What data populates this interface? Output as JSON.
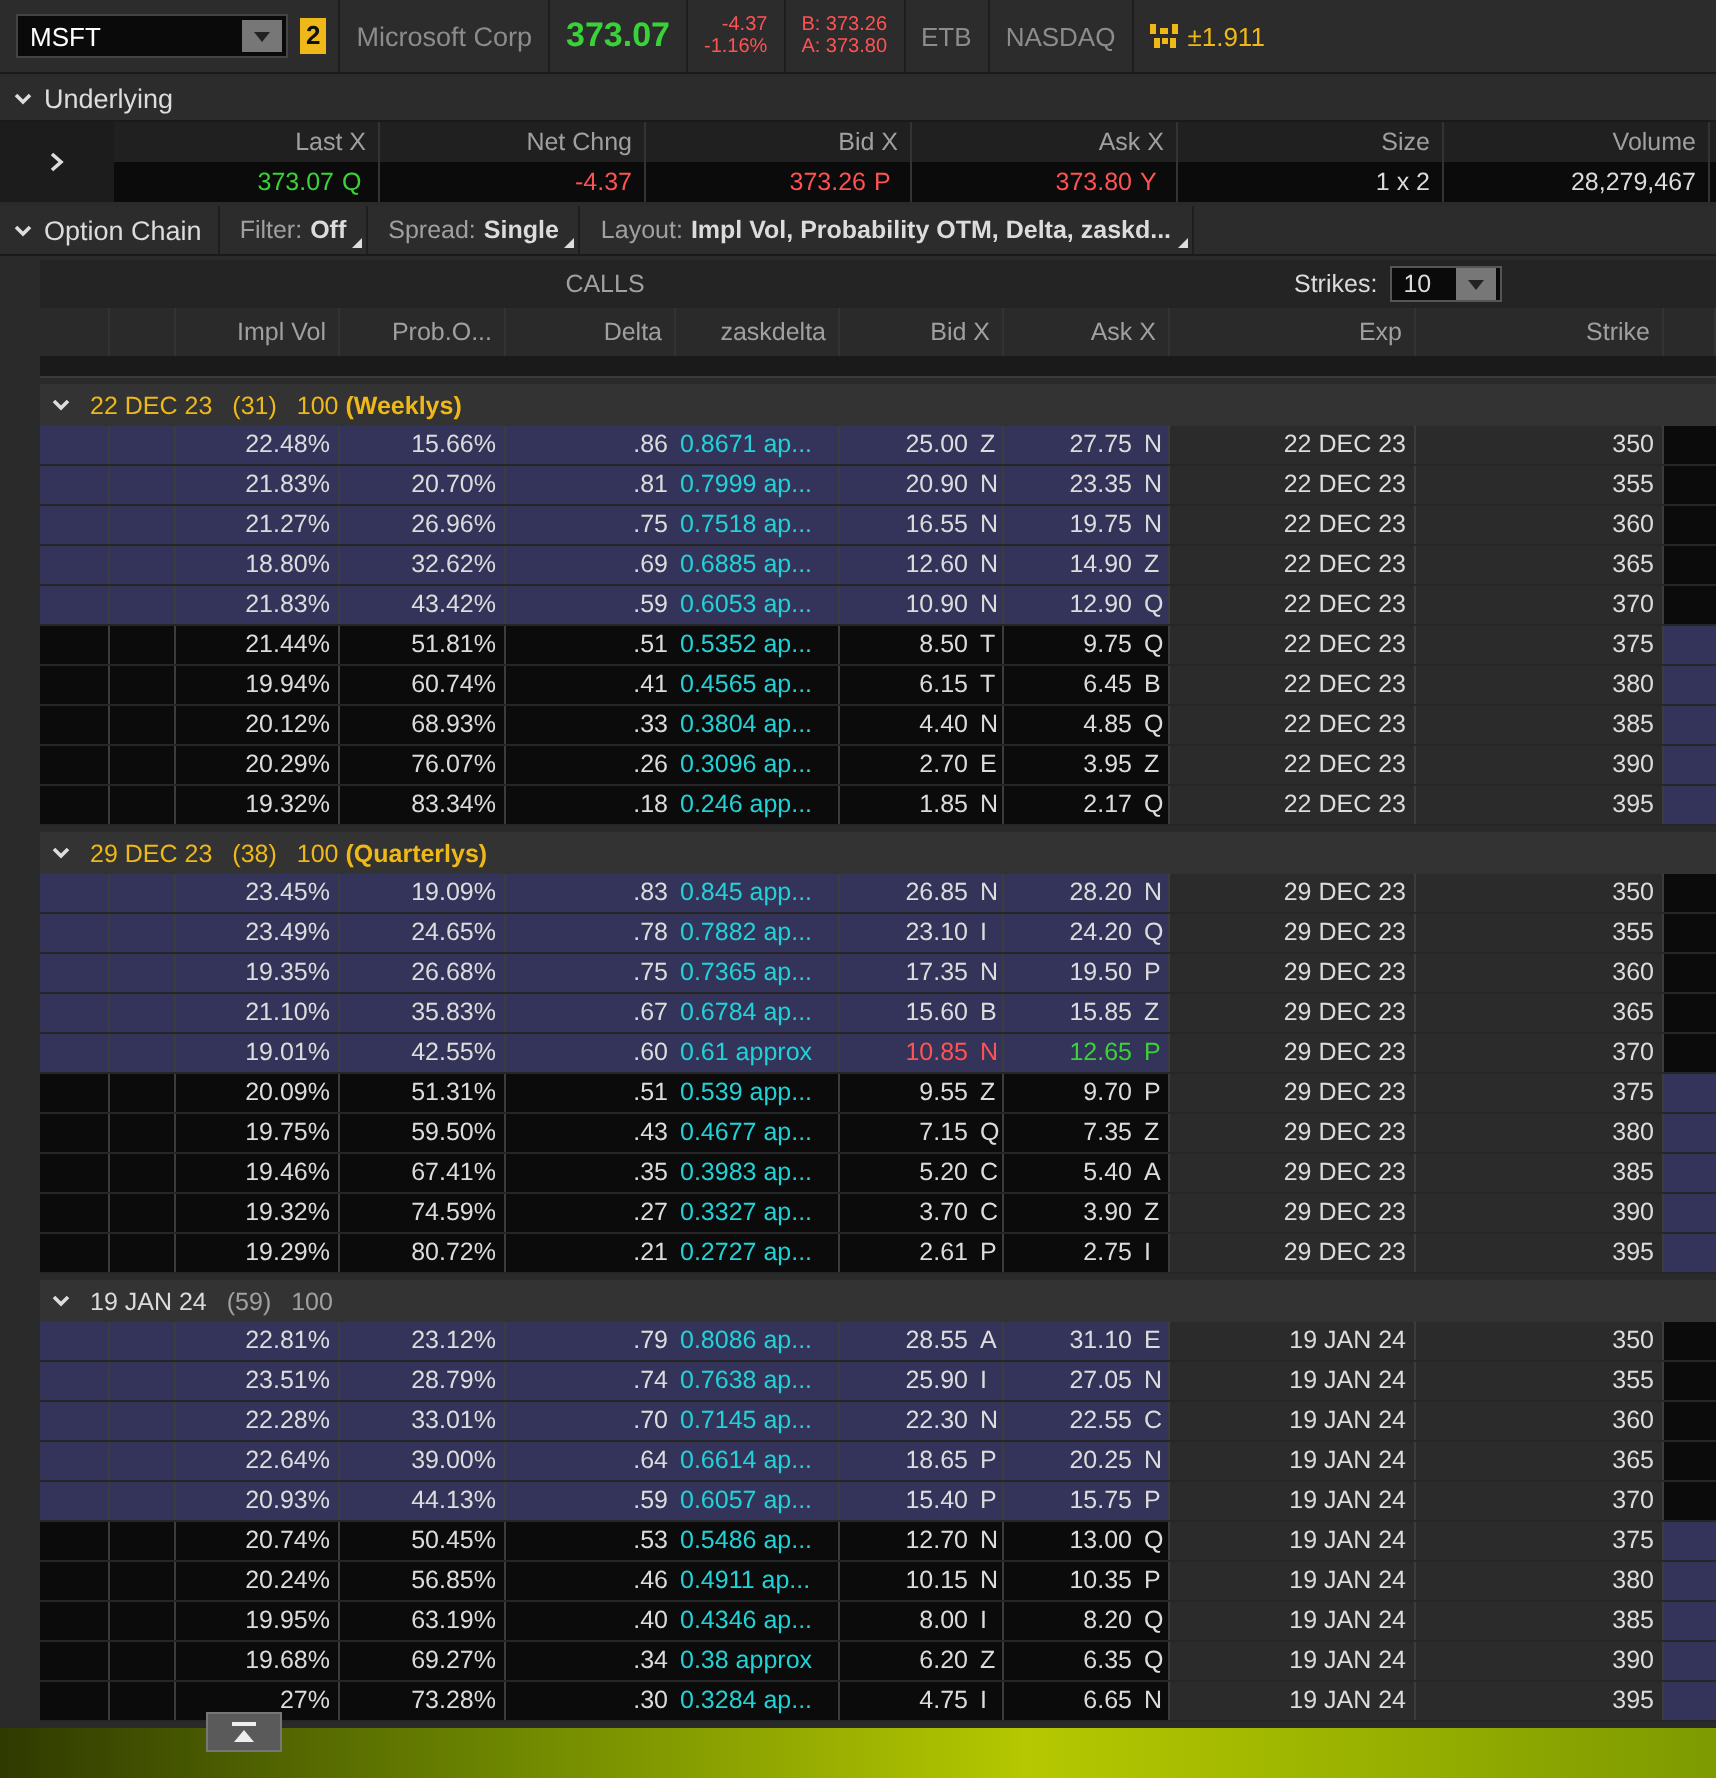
{
  "quote_bar": {
    "symbol": "MSFT",
    "badge": "2",
    "company": "Microsoft Corp",
    "last": "373.07",
    "change": "-4.37",
    "change_pct": "-1.16%",
    "bid": "B: 373.26",
    "ask": "A: 373.80",
    "borrow": "ETB",
    "exchange": "NASDAQ",
    "move": "±1.911"
  },
  "underlying": {
    "title": "Underlying",
    "expanded": true,
    "columns": [
      {
        "label": "Last X",
        "value": "373.07",
        "exchange": "Q",
        "up": true,
        "down": false
      },
      {
        "label": "Net Chng",
        "value": "-4.37",
        "up": false,
        "down": true
      },
      {
        "label": "Bid X",
        "value": "373.26",
        "exchange": "P",
        "up": false,
        "down": true
      },
      {
        "label": "Ask X",
        "value": "373.80",
        "exchange": "Y",
        "up": false,
        "down": true
      },
      {
        "label": "Size",
        "value": "1 x 2",
        "up": false,
        "down": false
      },
      {
        "label": "Volume",
        "value": "28,279,467",
        "up": false,
        "down": false
      }
    ]
  },
  "option_chain": {
    "title": "Option Chain",
    "expanded": true,
    "filter_label": "Filter:",
    "filter": "Off",
    "spread_label": "Spread:",
    "spread": "Single",
    "layout_label": "Layout:",
    "layout": "Impl Vol, Probability OTM, Delta, zaskd...",
    "calls_label": "CALLS",
    "strikes_label": "Strikes:",
    "strikes": "10"
  },
  "columns": [
    "Impl Vol",
    "Prob.O...",
    "Delta",
    "zaskdelta",
    "Bid X",
    "Ask X",
    "Exp",
    "Strike"
  ],
  "sections": [
    {
      "date": "22 DEC 23",
      "count": "(31)",
      "multiplier": "100",
      "tag": "(Weeklys)",
      "highlight": true,
      "expanded": true,
      "rows": [
        {
          "iv": "22.48%",
          "prob": "15.66%",
          "delta": ".86",
          "zask": "0.8671 ap...",
          "bid": "25.00",
          "bid_ex": "Z",
          "ask": "27.75",
          "ask_ex": "N",
          "exp": "22 DEC 23",
          "strike": "350",
          "itm": true,
          "bid_down": false,
          "ask_up": false
        },
        {
          "iv": "21.83%",
          "prob": "20.70%",
          "delta": ".81",
          "zask": "0.7999 ap...",
          "bid": "20.90",
          "bid_ex": "N",
          "ask": "23.35",
          "ask_ex": "N",
          "exp": "22 DEC 23",
          "strike": "355",
          "itm": true,
          "bid_down": false,
          "ask_up": false
        },
        {
          "iv": "21.27%",
          "prob": "26.96%",
          "delta": ".75",
          "zask": "0.7518 ap...",
          "bid": "16.55",
          "bid_ex": "N",
          "ask": "19.75",
          "ask_ex": "N",
          "exp": "22 DEC 23",
          "strike": "360",
          "itm": true,
          "bid_down": false,
          "ask_up": false
        },
        {
          "iv": "18.80%",
          "prob": "32.62%",
          "delta": ".69",
          "zask": "0.6885 ap...",
          "bid": "12.60",
          "bid_ex": "N",
          "ask": "14.90",
          "ask_ex": "Z",
          "exp": "22 DEC 23",
          "strike": "365",
          "itm": true,
          "bid_down": false,
          "ask_up": false
        },
        {
          "iv": "21.83%",
          "prob": "43.42%",
          "delta": ".59",
          "zask": "0.6053 ap...",
          "bid": "10.90",
          "bid_ex": "N",
          "ask": "12.90",
          "ask_ex": "Q",
          "exp": "22 DEC 23",
          "strike": "370",
          "itm": true,
          "bid_down": false,
          "ask_up": false
        },
        {
          "iv": "21.44%",
          "prob": "51.81%",
          "delta": ".51",
          "zask": "0.5352 ap...",
          "bid": "8.50",
          "bid_ex": "T",
          "ask": "9.75",
          "ask_ex": "Q",
          "exp": "22 DEC 23",
          "strike": "375",
          "itm": false,
          "bid_down": false,
          "ask_up": false
        },
        {
          "iv": "19.94%",
          "prob": "60.74%",
          "delta": ".41",
          "zask": "0.4565 ap...",
          "bid": "6.15",
          "bid_ex": "T",
          "ask": "6.45",
          "ask_ex": "B",
          "exp": "22 DEC 23",
          "strike": "380",
          "itm": false,
          "bid_down": false,
          "ask_up": false
        },
        {
          "iv": "20.12%",
          "prob": "68.93%",
          "delta": ".33",
          "zask": "0.3804 ap...",
          "bid": "4.40",
          "bid_ex": "N",
          "ask": "4.85",
          "ask_ex": "Q",
          "exp": "22 DEC 23",
          "strike": "385",
          "itm": false,
          "bid_down": false,
          "ask_up": false
        },
        {
          "iv": "20.29%",
          "prob": "76.07%",
          "delta": ".26",
          "zask": "0.3096 ap...",
          "bid": "2.70",
          "bid_ex": "E",
          "ask": "3.95",
          "ask_ex": "Z",
          "exp": "22 DEC 23",
          "strike": "390",
          "itm": false,
          "bid_down": false,
          "ask_up": false
        },
        {
          "iv": "19.32%",
          "prob": "83.34%",
          "delta": ".18",
          "zask": "0.246 app...",
          "bid": "1.85",
          "bid_ex": "N",
          "ask": "2.17",
          "ask_ex": "Q",
          "exp": "22 DEC 23",
          "strike": "395",
          "itm": false,
          "bid_down": false,
          "ask_up": false
        }
      ]
    },
    {
      "date": "29 DEC 23",
      "count": "(38)",
      "multiplier": "100",
      "tag": "(Quarterlys)",
      "highlight": true,
      "expanded": true,
      "rows": [
        {
          "iv": "23.45%",
          "prob": "19.09%",
          "delta": ".83",
          "zask": "0.845 app...",
          "bid": "26.85",
          "bid_ex": "N",
          "ask": "28.20",
          "ask_ex": "N",
          "exp": "29 DEC 23",
          "strike": "350",
          "itm": true,
          "bid_down": false,
          "ask_up": false
        },
        {
          "iv": "23.49%",
          "prob": "24.65%",
          "delta": ".78",
          "zask": "0.7882 ap...",
          "bid": "23.10",
          "bid_ex": "I",
          "ask": "24.20",
          "ask_ex": "Q",
          "exp": "29 DEC 23",
          "strike": "355",
          "itm": true,
          "bid_down": false,
          "ask_up": false
        },
        {
          "iv": "19.35%",
          "prob": "26.68%",
          "delta": ".75",
          "zask": "0.7365 ap...",
          "bid": "17.35",
          "bid_ex": "N",
          "ask": "19.50",
          "ask_ex": "P",
          "exp": "29 DEC 23",
          "strike": "360",
          "itm": true,
          "bid_down": false,
          "ask_up": false
        },
        {
          "iv": "21.10%",
          "prob": "35.83%",
          "delta": ".67",
          "zask": "0.6784 ap...",
          "bid": "15.60",
          "bid_ex": "B",
          "ask": "15.85",
          "ask_ex": "Z",
          "exp": "29 DEC 23",
          "strike": "365",
          "itm": true,
          "bid_down": false,
          "ask_up": false
        },
        {
          "iv": "19.01%",
          "prob": "42.55%",
          "delta": ".60",
          "zask": "0.61 approx",
          "bid": "10.85",
          "bid_ex": "N",
          "ask": "12.65",
          "ask_ex": "P",
          "exp": "29 DEC 23",
          "strike": "370",
          "itm": true,
          "bid_down": true,
          "ask_up": true
        },
        {
          "iv": "20.09%",
          "prob": "51.31%",
          "delta": ".51",
          "zask": "0.539 app...",
          "bid": "9.55",
          "bid_ex": "Z",
          "ask": "9.70",
          "ask_ex": "P",
          "exp": "29 DEC 23",
          "strike": "375",
          "itm": false,
          "bid_down": false,
          "ask_up": false
        },
        {
          "iv": "19.75%",
          "prob": "59.50%",
          "delta": ".43",
          "zask": "0.4677 ap...",
          "bid": "7.15",
          "bid_ex": "Q",
          "ask": "7.35",
          "ask_ex": "Z",
          "exp": "29 DEC 23",
          "strike": "380",
          "itm": false,
          "bid_down": false,
          "ask_up": false
        },
        {
          "iv": "19.46%",
          "prob": "67.41%",
          "delta": ".35",
          "zask": "0.3983 ap...",
          "bid": "5.20",
          "bid_ex": "C",
          "ask": "5.40",
          "ask_ex": "A",
          "exp": "29 DEC 23",
          "strike": "385",
          "itm": false,
          "bid_down": false,
          "ask_up": false
        },
        {
          "iv": "19.32%",
          "prob": "74.59%",
          "delta": ".27",
          "zask": "0.3327 ap...",
          "bid": "3.70",
          "bid_ex": "C",
          "ask": "3.90",
          "ask_ex": "Z",
          "exp": "29 DEC 23",
          "strike": "390",
          "itm": false,
          "bid_down": false,
          "ask_up": false
        },
        {
          "iv": "19.29%",
          "prob": "80.72%",
          "delta": ".21",
          "zask": "0.2727 ap...",
          "bid": "2.61",
          "bid_ex": "P",
          "ask": "2.75",
          "ask_ex": "I",
          "exp": "29 DEC 23",
          "strike": "395",
          "itm": false,
          "bid_down": false,
          "ask_up": false
        }
      ]
    },
    {
      "date": "19 JAN 24",
      "count": "(59)",
      "multiplier": "100",
      "highlight": false,
      "expanded": true,
      "rows": [
        {
          "iv": "22.81%",
          "prob": "23.12%",
          "delta": ".79",
          "zask": "0.8086 ap...",
          "bid": "28.55",
          "bid_ex": "A",
          "ask": "31.10",
          "ask_ex": "E",
          "exp": "19 JAN 24",
          "strike": "350",
          "itm": true,
          "bid_down": false,
          "ask_up": false
        },
        {
          "iv": "23.51%",
          "prob": "28.79%",
          "delta": ".74",
          "zask": "0.7638 ap...",
          "bid": "25.90",
          "bid_ex": "I",
          "ask": "27.05",
          "ask_ex": "N",
          "exp": "19 JAN 24",
          "strike": "355",
          "itm": true,
          "bid_down": false,
          "ask_up": false
        },
        {
          "iv": "22.28%",
          "prob": "33.01%",
          "delta": ".70",
          "zask": "0.7145 ap...",
          "bid": "22.30",
          "bid_ex": "N",
          "ask": "22.55",
          "ask_ex": "C",
          "exp": "19 JAN 24",
          "strike": "360",
          "itm": true,
          "bid_down": false,
          "ask_up": false
        },
        {
          "iv": "22.64%",
          "prob": "39.00%",
          "delta": ".64",
          "zask": "0.6614 ap...",
          "bid": "18.65",
          "bid_ex": "P",
          "ask": "20.25",
          "ask_ex": "N",
          "exp": "19 JAN 24",
          "strike": "365",
          "itm": true,
          "bid_down": false,
          "ask_up": false
        },
        {
          "iv": "20.93%",
          "prob": "44.13%",
          "delta": ".59",
          "zask": "0.6057 ap...",
          "bid": "15.40",
          "bid_ex": "P",
          "ask": "15.75",
          "ask_ex": "P",
          "exp": "19 JAN 24",
          "strike": "370",
          "itm": true,
          "bid_down": false,
          "ask_up": false
        },
        {
          "iv": "20.74%",
          "prob": "50.45%",
          "delta": ".53",
          "zask": "0.5486 ap...",
          "bid": "12.70",
          "bid_ex": "N",
          "ask": "13.00",
          "ask_ex": "Q",
          "exp": "19 JAN 24",
          "strike": "375",
          "itm": false,
          "bid_down": false,
          "ask_up": false
        },
        {
          "iv": "20.24%",
          "prob": "56.85%",
          "delta": ".46",
          "zask": "0.4911 ap...",
          "bid": "10.15",
          "bid_ex": "N",
          "ask": "10.35",
          "ask_ex": "P",
          "exp": "19 JAN 24",
          "strike": "380",
          "itm": false,
          "bid_down": false,
          "ask_up": false
        },
        {
          "iv": "19.95%",
          "prob": "63.19%",
          "delta": ".40",
          "zask": "0.4346 ap...",
          "bid": "8.00",
          "bid_ex": "I",
          "ask": "8.20",
          "ask_ex": "Q",
          "exp": "19 JAN 24",
          "strike": "385",
          "itm": false,
          "bid_down": false,
          "ask_up": false
        },
        {
          "iv": "19.68%",
          "prob": "69.27%",
          "delta": ".34",
          "zask": "0.38 approx",
          "bid": "6.20",
          "bid_ex": "Z",
          "ask": "6.35",
          "ask_ex": "Q",
          "exp": "19 JAN 24",
          "strike": "390",
          "itm": false,
          "bid_down": false,
          "ask_up": false
        },
        {
          "iv": "27%",
          "prob": "73.28%",
          "delta": ".30",
          "zask": "0.3284 ap...",
          "bid": "4.75",
          "bid_ex": "I",
          "ask": "6.65",
          "ask_ex": "N",
          "exp": "19 JAN 24",
          "strike": "395",
          "itm": false,
          "bid_down": false,
          "ask_up": false
        }
      ]
    }
  ]
}
